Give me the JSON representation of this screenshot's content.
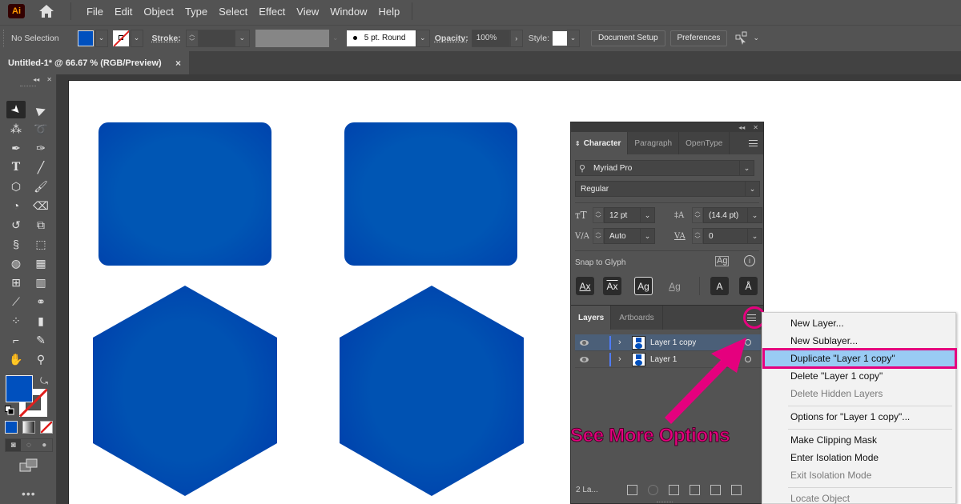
{
  "app": {
    "logo": "Ai",
    "menus": [
      "File",
      "Edit",
      "Object",
      "Type",
      "Select",
      "Effect",
      "View",
      "Window",
      "Help"
    ]
  },
  "control_bar": {
    "selection_status": "No Selection",
    "stroke_label": "Stroke:",
    "brush": "5 pt. Round",
    "opacity_label": "Opacity:",
    "opacity_value": "100%",
    "style_label": "Style:",
    "document_setup": "Document Setup",
    "preferences": "Preferences",
    "colors": {
      "fill": "#0050be",
      "stroke_none_slash": "#e0201e"
    }
  },
  "document_tab": {
    "title": "Untitled-1* @ 66.67 % (RGB/Preview)",
    "close": "×"
  },
  "artboard": {
    "shapes": [
      {
        "type": "rounded-rectangle",
        "color": "#0050b4"
      },
      {
        "type": "rounded-rectangle",
        "color": "#0050b4"
      },
      {
        "type": "hexagon",
        "color": "#0050b4"
      },
      {
        "type": "hexagon",
        "color": "#0050b4"
      }
    ]
  },
  "tools": {
    "items": [
      "selection",
      "direct-selection",
      "magic-wand",
      "lasso",
      "pen",
      "curvature",
      "type",
      "line-segment",
      "polygon",
      "paintbrush",
      "shaper",
      "eraser",
      "rotate",
      "scale",
      "puppet-warp",
      "free-transform",
      "shape-builder",
      "perspective-grid",
      "mesh",
      "gradient",
      "eyedropper",
      "blend",
      "symbol-sprayer",
      "column-graph",
      "artboard",
      "slice",
      "hand",
      "zoom"
    ],
    "more": "•••"
  },
  "character_panel": {
    "tabs": [
      "Character",
      "Paragraph",
      "OpenType"
    ],
    "font_family": "Myriad Pro",
    "font_style": "Regular",
    "font_size": "12 pt",
    "leading": "(14.4 pt)",
    "kerning": "Auto",
    "tracking": "0",
    "snap_label": "Snap to Glyph",
    "snap_buttons": [
      "Ax",
      "Ax",
      "Ag",
      "Ag",
      "A",
      "Å"
    ]
  },
  "layers_panel": {
    "tabs": [
      "Layers",
      "Artboards"
    ],
    "layers": [
      {
        "name": "Layer 1 copy",
        "selected": true,
        "color": "#4f7cff"
      },
      {
        "name": "Layer 1",
        "selected": false,
        "color": "#4f7cff"
      }
    ],
    "footer_count": "2 La..."
  },
  "flyout_menu": {
    "items": [
      {
        "label": "New Layer...",
        "disabled": false
      },
      {
        "label": "New Sublayer...",
        "disabled": false
      },
      {
        "label": "Duplicate \"Layer 1 copy\"",
        "disabled": false,
        "highlighted": true
      },
      {
        "label": "Delete \"Layer 1 copy\"",
        "disabled": false
      },
      {
        "label": "Delete Hidden Layers",
        "disabled": true
      },
      {
        "label": "Options for \"Layer 1 copy\"...",
        "disabled": false
      },
      {
        "label": "Make Clipping Mask",
        "disabled": false
      },
      {
        "label": "Enter Isolation Mode",
        "disabled": false
      },
      {
        "label": "Exit Isolation Mode",
        "disabled": true
      },
      {
        "label": "Locate Object",
        "disabled": true
      }
    ]
  },
  "annotation": {
    "text": "See More Options",
    "color": "#e5007e"
  }
}
